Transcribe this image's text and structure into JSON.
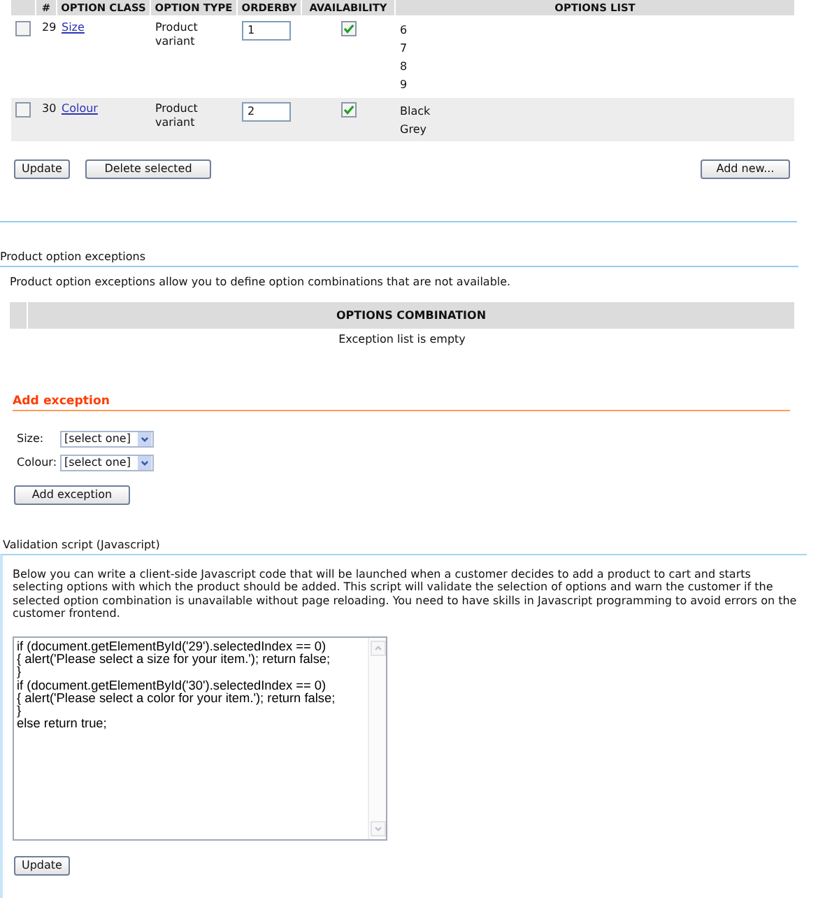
{
  "options_table": {
    "columns": [
      "#",
      "OPTION CLASS",
      "OPTION TYPE",
      "ORDERBY",
      "AVAILABILITY",
      "OPTIONS LIST"
    ],
    "rows": [
      {
        "selected": false,
        "number": "29",
        "option_class": "Size",
        "option_type": "Product variant",
        "orderby": "1",
        "available": true,
        "options": [
          "6",
          "7",
          "8",
          "9"
        ]
      },
      {
        "selected": false,
        "number": "30",
        "option_class": "Colour",
        "option_type": "Product variant",
        "orderby": "2",
        "available": true,
        "options": [
          "Black",
          "Grey"
        ]
      }
    ]
  },
  "table_actions": {
    "left_buttons": [
      "Update",
      "Delete selected"
    ],
    "right_button": "Add new..."
  },
  "exceptions": {
    "title": "Product option exceptions",
    "description": "Product option exceptions allow you to define option combinations that are not available.",
    "columns": [
      "OPTIONS COMBINATION"
    ],
    "empty_message": "Exception list is empty"
  },
  "add_exception": {
    "title": "Add exception",
    "fields": [
      {
        "label": "Size:",
        "value": "[select one]"
      },
      {
        "label": "Colour:",
        "value": "[select one]"
      }
    ],
    "button": "Add exception"
  },
  "validation_script": {
    "title": "Validation script (Javascript)",
    "description": "Below you can write a client-side Javascript code that will be launched when a customer decides to add a product to cart and starts selecting options with which the product should be added. This script will validate the selection of options and warn the customer if the selected option combination is unavailable without page reloading. You need to have skills in Javascript programming to avoid errors on the customer frontend.",
    "code": "if (document.getElementById('29').selectedIndex == 0)\n{ alert('Please select a size for your item.'); return false;\n}\nif (document.getElementById('30').selectedIndex == 0)\n{ alert('Please select a color for your item.'); return false;\n}\nelse return true;",
    "button": "Update"
  }
}
